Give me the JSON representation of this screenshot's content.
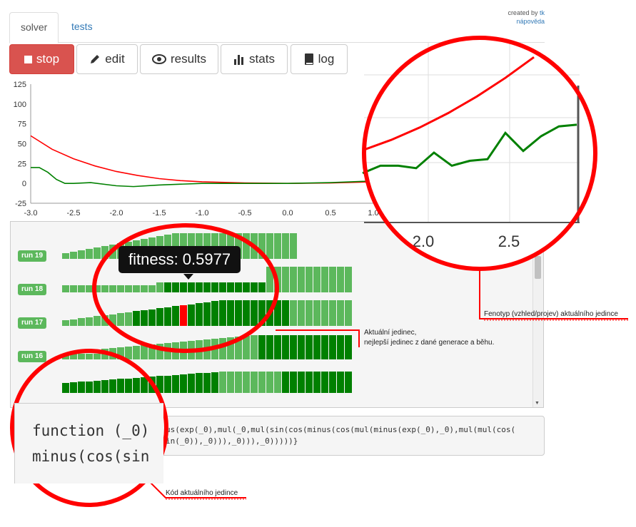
{
  "tabs": {
    "solver": "solver",
    "tests": "tests"
  },
  "credits": {
    "created_by": "created by",
    "author": "tk",
    "help": "nápověda"
  },
  "toolbar": {
    "stop": "stop",
    "edit": "edit",
    "results": "results",
    "stats": "stats",
    "log": "log"
  },
  "colors": {
    "stop": "#d9534f",
    "best": "#ff0000",
    "current": "#008000",
    "run_label": "#5cb85c",
    "annotation": "#ff0000"
  },
  "chart_data": {
    "type": "line",
    "xlim": [
      -3.0,
      3.0
    ],
    "ylim": [
      -25,
      125
    ],
    "x_ticks": [
      "-3.0",
      "-2.5",
      "-2.0",
      "-1.5",
      "-1.0",
      "-0.5",
      "0.0",
      "0.5",
      "1.0"
    ],
    "y_ticks": [
      "125",
      "100",
      "75",
      "50",
      "25",
      "0",
      "-25"
    ],
    "series": [
      {
        "color": "#ff0000",
        "x": [
          -3.0,
          -2.75,
          -2.5,
          -2.25,
          -2.0,
          -1.75,
          -1.5,
          -1.25,
          -1.0,
          -0.5,
          0.0,
          0.5,
          1.0
        ],
        "y": [
          60,
          43,
          31,
          22,
          15,
          10,
          6,
          3.5,
          2,
          0.5,
          0,
          0.5,
          2
        ]
      },
      {
        "color": "#008000",
        "x": [
          -3.0,
          -2.9,
          -2.8,
          -2.7,
          -2.6,
          -2.5,
          -2.3,
          -2.0,
          -1.8,
          -1.5,
          -1.0,
          -0.5,
          0.0,
          0.5,
          1.0
        ],
        "y": [
          20,
          20,
          14,
          5,
          0,
          0,
          1,
          -3,
          -4,
          -2,
          0,
          0,
          0,
          1,
          3
        ]
      }
    ]
  },
  "zoom_chart": {
    "x_ticks": [
      "2.0",
      "2.5"
    ],
    "best_y": [
      34,
      44,
      56,
      70,
      86,
      104,
      124
    ],
    "current_y": [
      15,
      24,
      24,
      21,
      40,
      24,
      30,
      32,
      64,
      42,
      60,
      72,
      74
    ]
  },
  "runs": [
    {
      "label": "run 19"
    },
    {
      "label": "run 18"
    },
    {
      "label": "run 17"
    },
    {
      "label": "run 16"
    }
  ],
  "tooltip": "fitness: 0.5977",
  "code": {
    "line1": "us(exp(_0),mul(_0,mul(sin(cos(minus(cos(mul(minus(exp(_0),_0),mul(mul(cos(",
    "line2": "in(_0)),_0))),_0))),_0)))))}",
    "zoom_line1": "function (_0)",
    "zoom_line2": "minus(cos(sin"
  },
  "annotations": {
    "phenotype": "Fenotyp (vzhled/projev) aktuálního jedince",
    "current_line1": "Aktuální jedinec,",
    "current_line2": "nejlepší jedinec z dané generace a běhu.",
    "code": "Kód aktuálního jedince"
  }
}
